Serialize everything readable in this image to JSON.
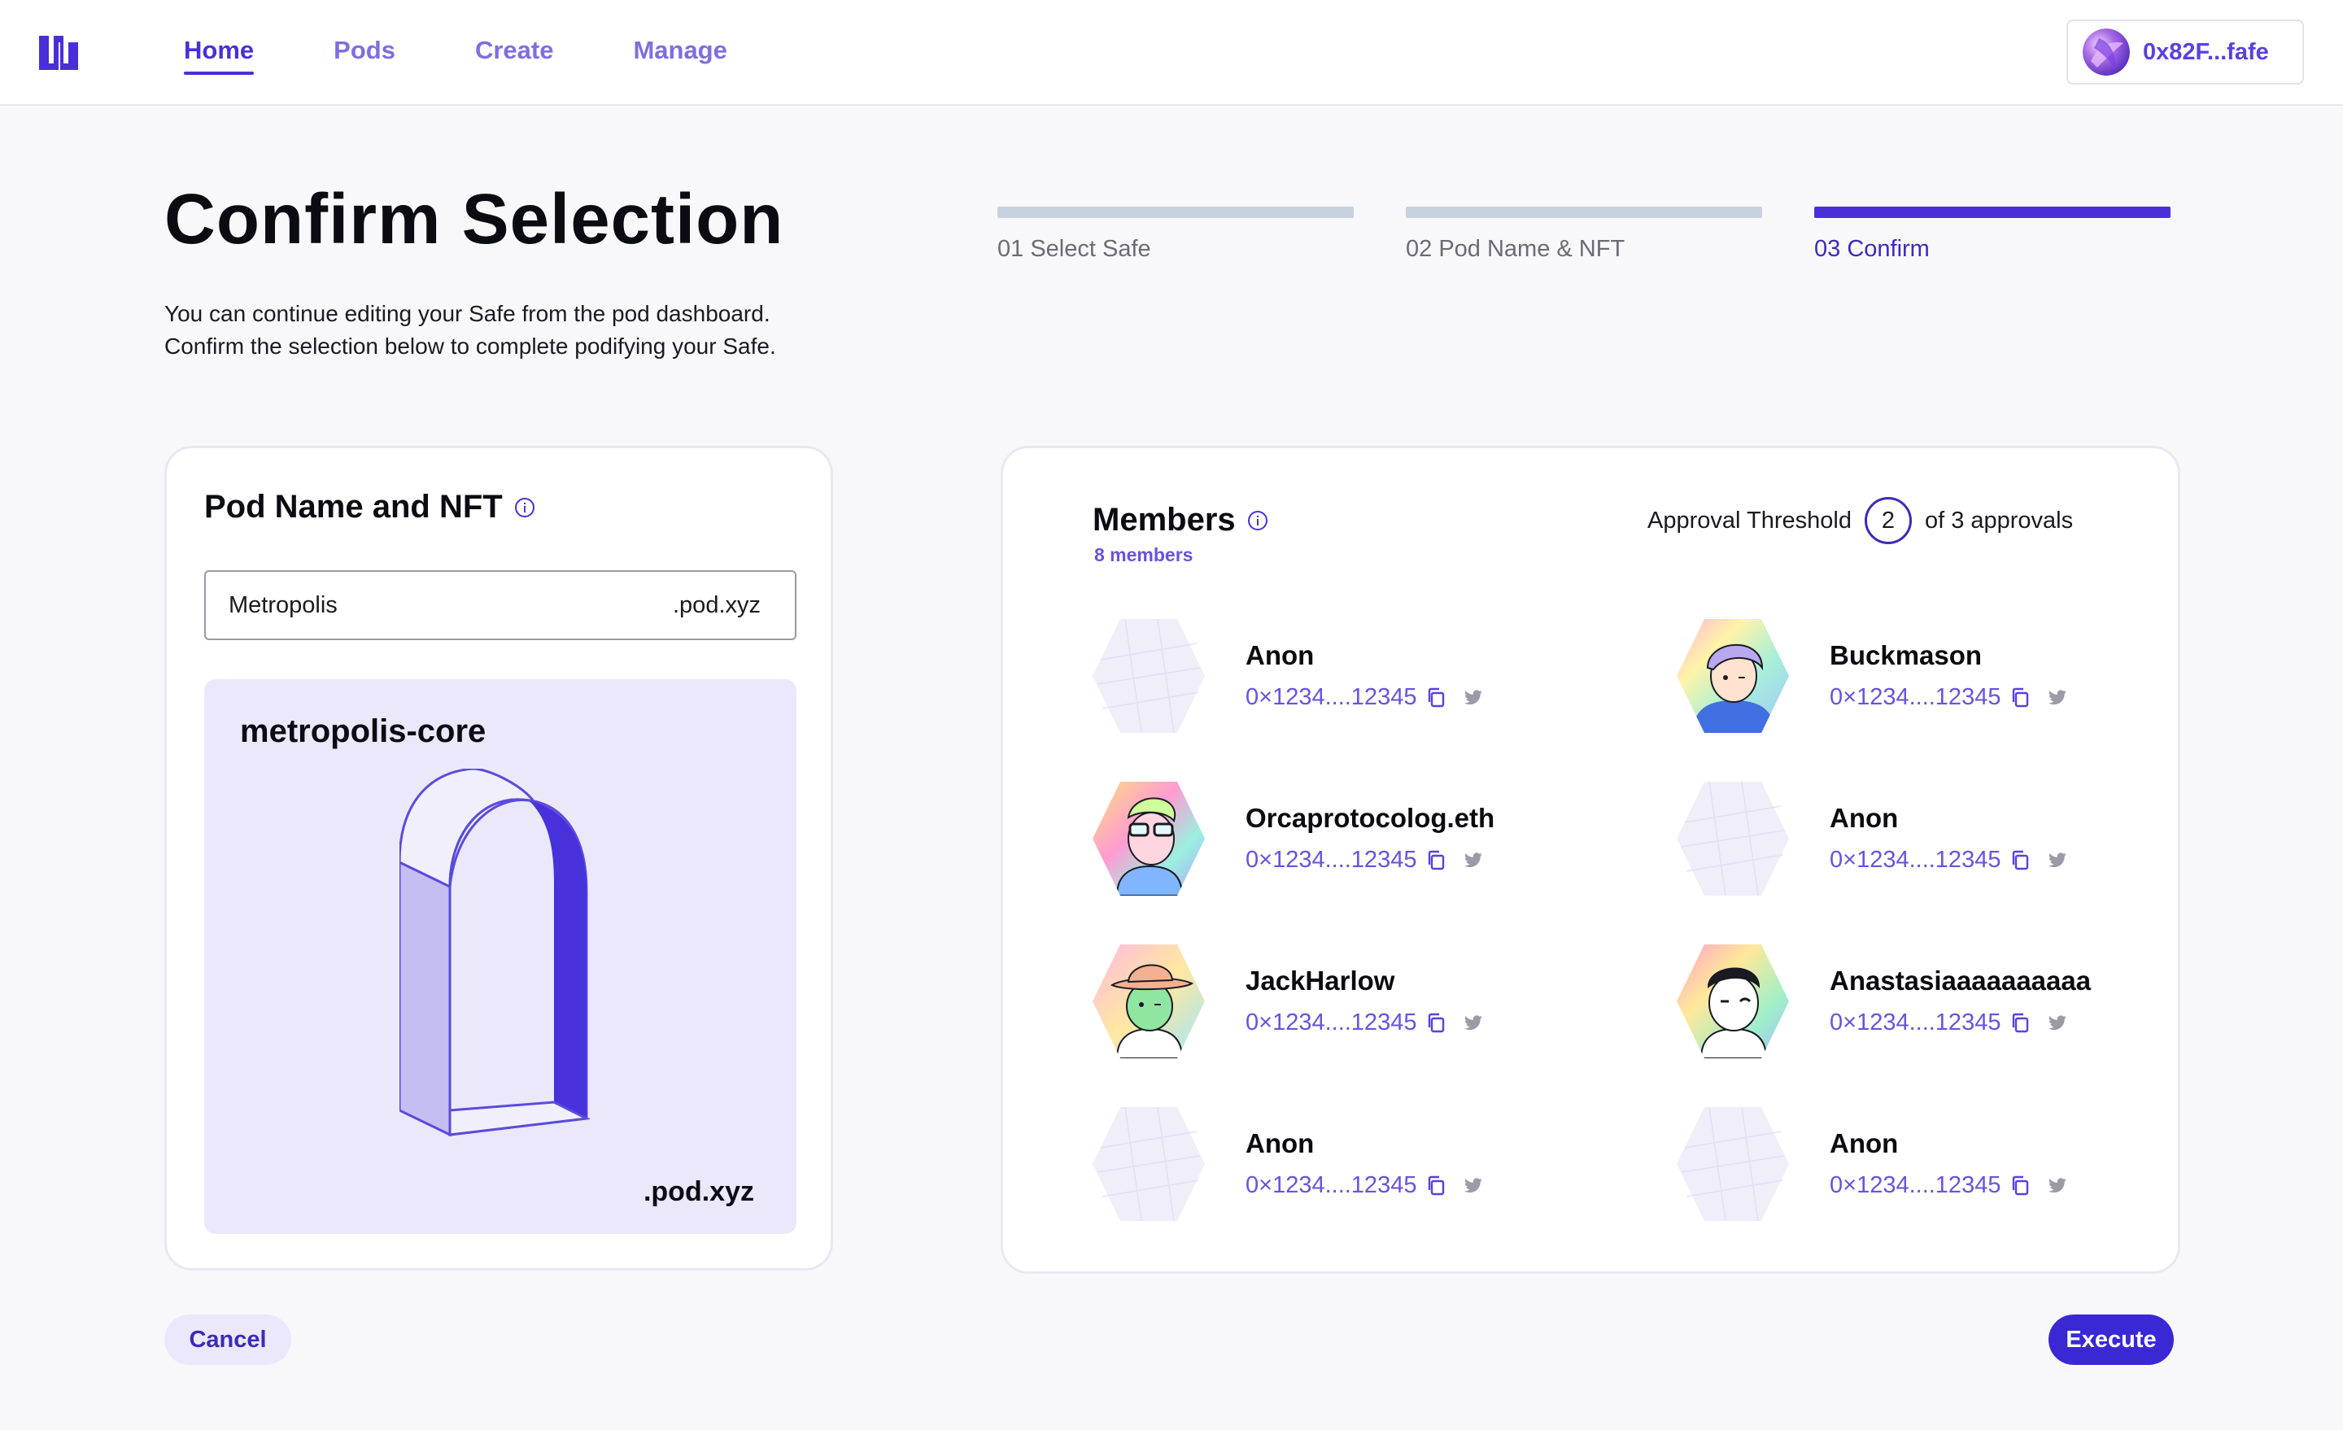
{
  "nav": {
    "items": [
      {
        "label": "Home",
        "active": true
      },
      {
        "label": "Pods",
        "active": false
      },
      {
        "label": "Create",
        "active": false
      },
      {
        "label": "Manage",
        "active": false
      }
    ]
  },
  "wallet": {
    "address": "0x82F...fafe"
  },
  "page": {
    "title": "Confirm Selection",
    "subtitle_line1": "You can continue editing your Safe from the pod dashboard.",
    "subtitle_line2": "Confirm the selection below to complete podifying your Safe."
  },
  "stepper": {
    "steps": [
      {
        "label": "01 Select Safe",
        "state": "done"
      },
      {
        "label": "02 Pod Name & NFT",
        "state": "done"
      },
      {
        "label": "03 Confirm",
        "state": "current"
      }
    ]
  },
  "pod": {
    "title": "Pod Name and NFT",
    "name_value": "Metropolis",
    "suffix": ".pod.xyz",
    "nft_name": "metropolis-core",
    "nft_suffix": ".pod.xyz"
  },
  "members": {
    "title": "Members",
    "count_label": "8 members",
    "threshold_label": "Approval Threshold",
    "threshold_value": "2",
    "threshold_suffix": "of 3 approvals",
    "list": [
      {
        "name": "Anon",
        "address": "0×1234....12345",
        "avatar": "placeholder"
      },
      {
        "name": "Buckmason",
        "address": "0×1234....12345",
        "avatar": "rainbow-hair"
      },
      {
        "name": "Orcaprotocolog.eth",
        "address": "0×1234....12345",
        "avatar": "glasses"
      },
      {
        "name": "Anon",
        "address": "0×1234....12345",
        "avatar": "placeholder"
      },
      {
        "name": "JackHarlow",
        "address": "0×1234....12345",
        "avatar": "cowboy"
      },
      {
        "name": "Anastasiaaaaaaaaaa",
        "address": "0×1234....12345",
        "avatar": "wink"
      },
      {
        "name": "Anon",
        "address": "0×1234....12345",
        "avatar": "placeholder"
      },
      {
        "name": "Anon",
        "address": "0×1234....12345",
        "avatar": "placeholder"
      }
    ]
  },
  "actions": {
    "cancel": "Cancel",
    "execute": "Execute"
  },
  "colors": {
    "accent": "#4A2FD8",
    "accent_light": "#EAE8FA",
    "link": "#6A52DC"
  }
}
